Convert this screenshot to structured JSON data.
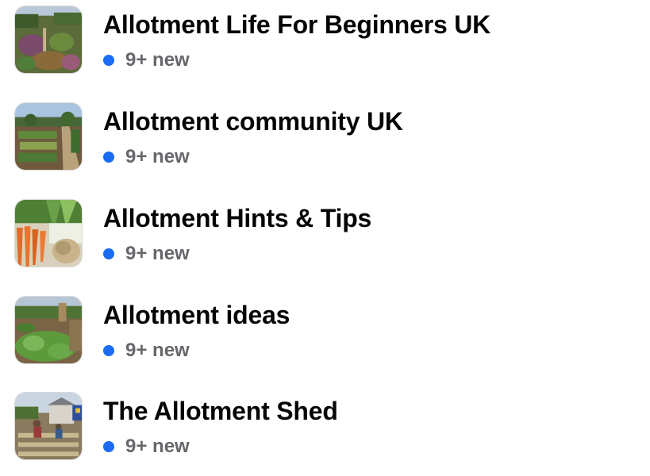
{
  "colors": {
    "unread_dot": "#1b6cf2",
    "title_text": "#050505",
    "meta_text": "#65676b"
  },
  "groups": [
    {
      "name": "Allotment Life For Beginners UK",
      "new_label": "9+ new",
      "thumbnail": "allotment-garden-photo"
    },
    {
      "name": "Allotment community UK",
      "new_label": "9+ new",
      "thumbnail": "allotment-plots-photo"
    },
    {
      "name": "Allotment Hints & Tips",
      "new_label": "9+ new",
      "thumbnail": "carrots-leeks-photo"
    },
    {
      "name": "Allotment ideas",
      "new_label": "9+ new",
      "thumbnail": "vegetable-bed-photo"
    },
    {
      "name": "The Allotment Shed",
      "new_label": "9+ new",
      "thumbnail": "shed-and-gardener-photo"
    }
  ]
}
